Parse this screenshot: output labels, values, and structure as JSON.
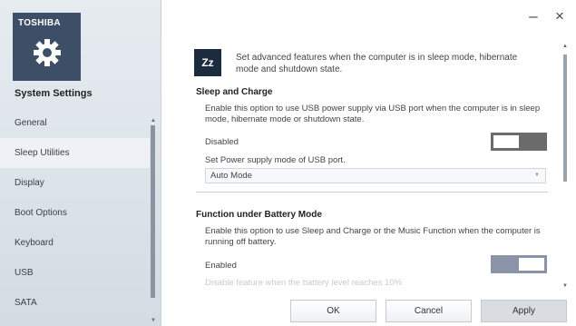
{
  "app": {
    "brand": "TOSHIBA",
    "title": "System Settings"
  },
  "window": {
    "minimize_label": "–",
    "close_label": "×"
  },
  "sidebar": {
    "items": [
      {
        "label": "General",
        "active": false
      },
      {
        "label": "Sleep Utilities",
        "active": true
      },
      {
        "label": "Display",
        "active": false
      },
      {
        "label": "Boot Options",
        "active": false
      },
      {
        "label": "Keyboard",
        "active": false
      },
      {
        "label": "USB",
        "active": false
      },
      {
        "label": "SATA",
        "active": false
      }
    ]
  },
  "main": {
    "intro_icon": "Zz",
    "intro_text": "Set advanced features when the computer is in sleep mode, hibernate mode and shutdown state.",
    "sleep_charge": {
      "title": "Sleep and Charge",
      "description": "Enable this option to use USB power supply via USB port when the computer is in sleep mode, hibernate mode or shutdown state.",
      "status_label": "Disabled",
      "toggle_on": false,
      "supply_label": "Set Power supply mode of USB port.",
      "supply_value": "Auto Mode"
    },
    "battery_mode": {
      "title": "Function under Battery Mode",
      "description": "Enable this option to use Sleep and Charge or the Music Function when the computer is running off battery.",
      "status_label": "Enabled",
      "toggle_on": true,
      "faded_text": "Disable feature when the battery level reaches 10%"
    }
  },
  "footer": {
    "ok": "OK",
    "cancel": "Cancel",
    "apply": "Apply"
  },
  "colors": {
    "logo_bg": "#3d4f66",
    "sidebar_bg": "#dde4ea",
    "scrollbar": "#8b95a0"
  }
}
